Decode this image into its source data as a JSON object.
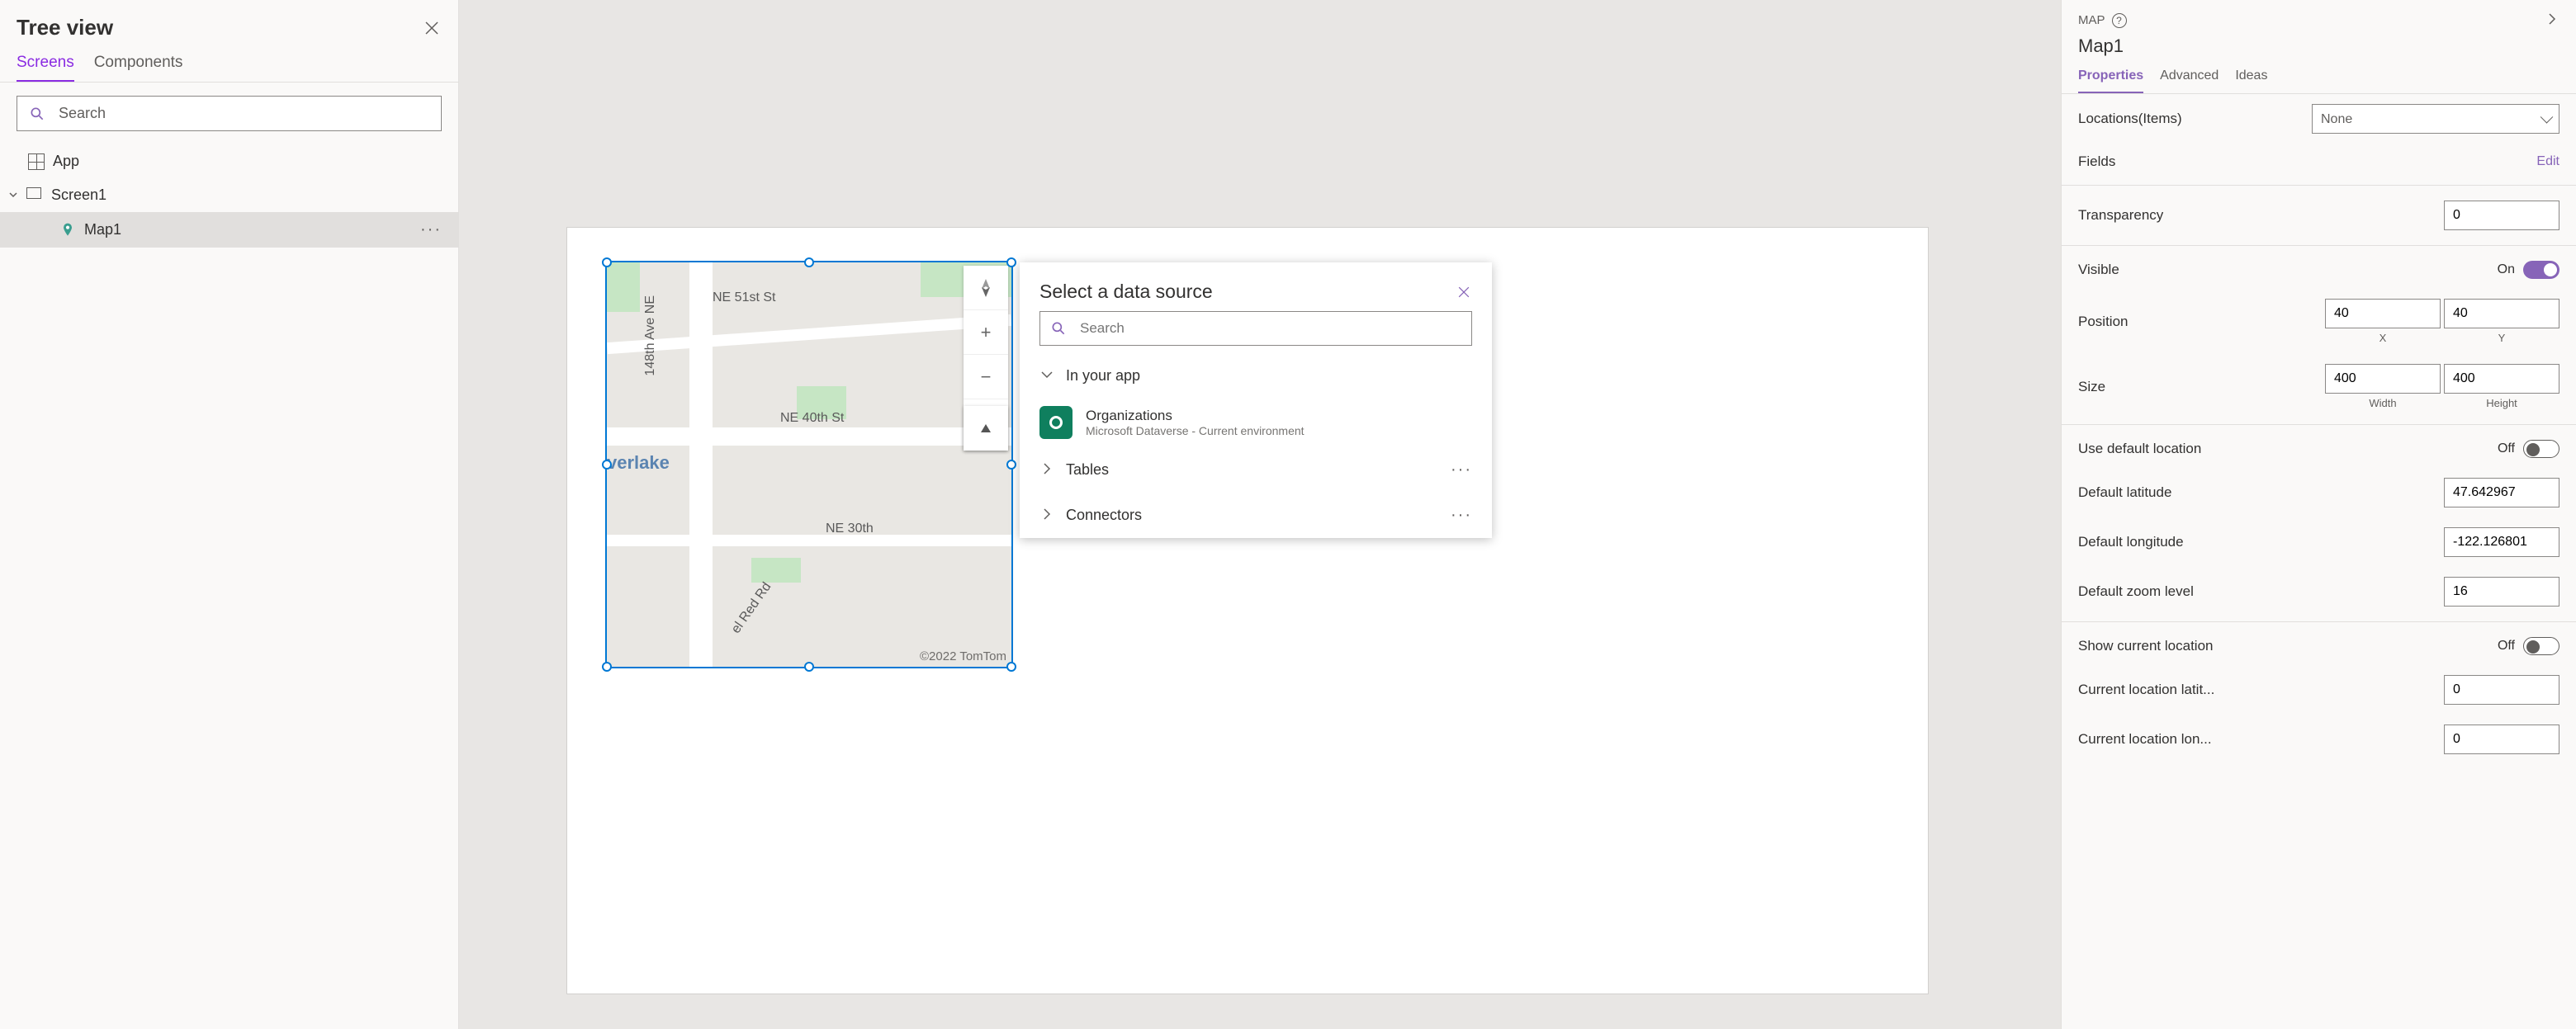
{
  "treeview": {
    "title": "Tree view",
    "tabs": {
      "screens": "Screens",
      "components": "Components"
    },
    "search_placeholder": "Search",
    "app_label": "App",
    "screen_label": "Screen1",
    "map_label": "Map1"
  },
  "map": {
    "street1": "NE 51st St",
    "street2": "NE 40th St",
    "street3": "NE 30th",
    "avenue": "148th Ave NE",
    "road": "el Red Rd",
    "place": "verlake",
    "copyright": "©2022 TomTom"
  },
  "popup": {
    "title": "Select a data source",
    "search_placeholder": "Search",
    "section_in_app": "In your app",
    "item_org_title": "Organizations",
    "item_org_sub": "Microsoft Dataverse - Current environment",
    "section_tables": "Tables",
    "section_connectors": "Connectors"
  },
  "rp": {
    "type": "MAP",
    "name": "Map1",
    "tabs": {
      "properties": "Properties",
      "advanced": "Advanced",
      "ideas": "Ideas"
    },
    "locations_label": "Locations(Items)",
    "locations_value": "None",
    "fields_label": "Fields",
    "fields_link": "Edit",
    "transparency_label": "Transparency",
    "transparency_value": "0",
    "visible_label": "Visible",
    "visible_state": "On",
    "position_label": "Position",
    "pos_x": "40",
    "pos_y": "40",
    "pos_x_sub": "X",
    "pos_y_sub": "Y",
    "size_label": "Size",
    "size_w": "400",
    "size_h": "400",
    "size_w_sub": "Width",
    "size_h_sub": "Height",
    "default_loc_label": "Use default location",
    "default_loc_state": "Off",
    "lat_label": "Default latitude",
    "lat_value": "47.642967",
    "lon_label": "Default longitude",
    "lon_value": "-122.126801",
    "zoom_label": "Default zoom level",
    "zoom_value": "16",
    "show_cur_label": "Show current location",
    "show_cur_state": "Off",
    "cur_lat_label": "Current location latit...",
    "cur_lat_value": "0",
    "cur_lon_label": "Current location lon...",
    "cur_lon_value": "0"
  }
}
